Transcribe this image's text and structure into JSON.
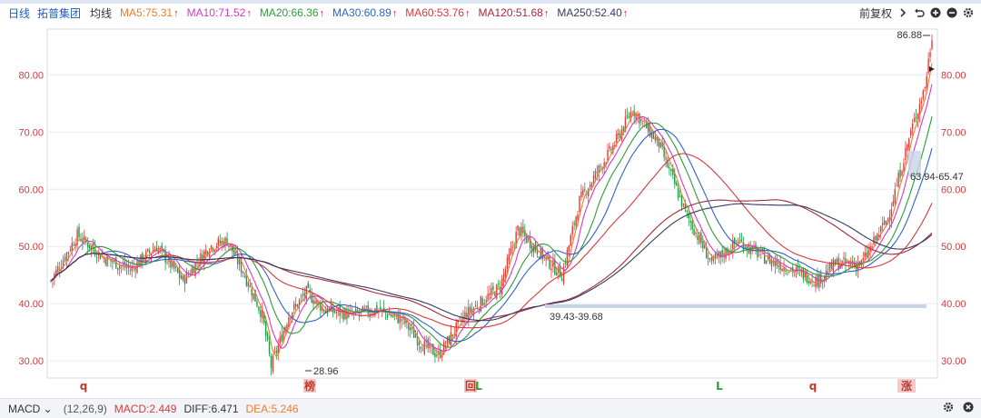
{
  "header": {
    "period": "日线",
    "stock_name": "拓普集团",
    "line_type": "均线",
    "ma": [
      {
        "label": "MA5:75.31",
        "color": "#ef7d2a"
      },
      {
        "label": "MA10:71.52",
        "color": "#d23ac8"
      },
      {
        "label": "MA20:66.36",
        "color": "#2e9b3a"
      },
      {
        "label": "MA30:60.89",
        "color": "#2f63c5"
      },
      {
        "label": "MA60:53.76",
        "color": "#d8393b"
      },
      {
        "label": "MA120:51.68",
        "color": "#a7283a"
      },
      {
        "label": "MA250:52.40",
        "color": "#343b62"
      }
    ],
    "right": {
      "adjust": "前复权"
    }
  },
  "chart": {
    "y_ticks": [
      "80.00",
      "70.00",
      "60.00",
      "50.00",
      "40.00",
      "30.00"
    ],
    "annotations": {
      "high": "86.88",
      "low": "28.96",
      "range_mid": "39.43-39.68",
      "range_right": "63.94-65.47"
    },
    "signals": [
      "q",
      "榜",
      "回",
      "L",
      "L",
      "q",
      "涨"
    ]
  },
  "bottom": {
    "indicator": "MACD",
    "params": "(12,26,9)",
    "macd": "MACD:2.449",
    "diff": "DIFF:6.471",
    "dea": "DEA:5.246",
    "colors": {
      "macd": "#d8393b",
      "diff": "#333333",
      "dea": "#ef7d2a"
    }
  },
  "chart_data": {
    "type": "line",
    "title": "",
    "ylim": [
      27,
      88
    ],
    "series": [
      {
        "name": "MA5",
        "color": "#ef7d2a"
      },
      {
        "name": "MA10",
        "color": "#d23ac8"
      },
      {
        "name": "MA20",
        "color": "#2e9b3a"
      },
      {
        "name": "MA30",
        "color": "#2f63c5"
      },
      {
        "name": "MA60",
        "color": "#d8393b"
      },
      {
        "name": "MA120",
        "color": "#a7283a"
      },
      {
        "name": "MA250",
        "color": "#343b62"
      }
    ],
    "price_path": [
      [
        0,
        44
      ],
      [
        15,
        52
      ],
      [
        30,
        48
      ],
      [
        45,
        46
      ],
      [
        60,
        50
      ],
      [
        75,
        44
      ],
      [
        90,
        50
      ],
      [
        100,
        51
      ],
      [
        110,
        45
      ],
      [
        120,
        38
      ],
      [
        125,
        29
      ],
      [
        135,
        38
      ],
      [
        145,
        42
      ],
      [
        155,
        39
      ],
      [
        170,
        38
      ],
      [
        185,
        39
      ],
      [
        200,
        37
      ],
      [
        210,
        33
      ],
      [
        220,
        31
      ],
      [
        235,
        38
      ],
      [
        255,
        43
      ],
      [
        265,
        53
      ],
      [
        280,
        48
      ],
      [
        290,
        45
      ],
      [
        300,
        58
      ],
      [
        320,
        68
      ],
      [
        330,
        74
      ],
      [
        345,
        68
      ],
      [
        360,
        56
      ],
      [
        375,
        47
      ],
      [
        390,
        51
      ],
      [
        405,
        48
      ],
      [
        420,
        46
      ],
      [
        435,
        44
      ],
      [
        445,
        47
      ],
      [
        460,
        47
      ],
      [
        475,
        55
      ],
      [
        488,
        70
      ],
      [
        496,
        78
      ],
      [
        500,
        86.88
      ]
    ]
  }
}
